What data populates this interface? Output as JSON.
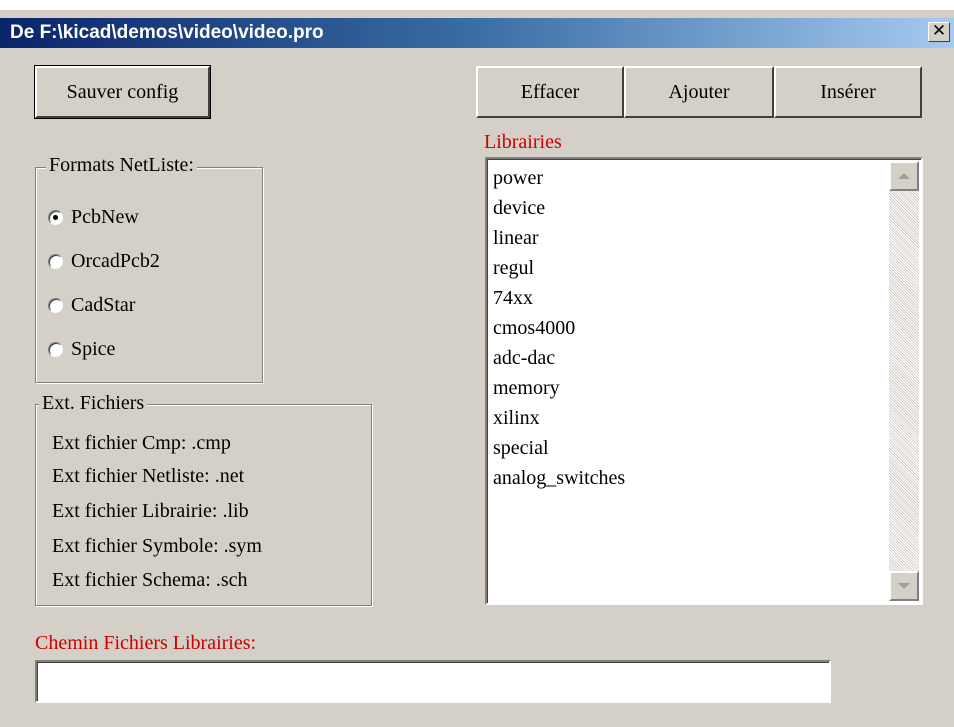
{
  "window": {
    "title": "De F:\\kicad\\demos\\video\\video.pro",
    "close_glyph": "✕"
  },
  "buttons": {
    "save_config": "Sauver config",
    "erase": "Effacer",
    "add": "Ajouter",
    "insert": "Insérer"
  },
  "netlist_formats": {
    "legend": "Formats NetListe:",
    "options": [
      {
        "label": "PcbNew",
        "checked": true
      },
      {
        "label": "OrcadPcb2",
        "checked": false
      },
      {
        "label": "CadStar",
        "checked": false
      },
      {
        "label": "Spice",
        "checked": false
      }
    ]
  },
  "ext_files": {
    "legend": "Ext. Fichiers",
    "lines": [
      "Ext fichier Cmp: .cmp",
      "Ext fichier Netliste: .net",
      "Ext fichier Librairie: .lib",
      "Ext fichier Symbole: .sym",
      "Ext fichier Schema: .sch"
    ]
  },
  "libraries": {
    "label": "Librairies",
    "items": [
      "power",
      "device",
      "linear",
      "regul",
      "74xx",
      "cmos4000",
      "adc-dac",
      "memory",
      "xilinx",
      "special",
      "analog_switches"
    ]
  },
  "lib_path": {
    "label": "Chemin Fichiers Librairies:",
    "value": ""
  },
  "colors": {
    "label_red": "#cc0000",
    "dialog_bg": "#d4d0c8",
    "title_start": "#0a246a",
    "title_end": "#a6caf0"
  }
}
